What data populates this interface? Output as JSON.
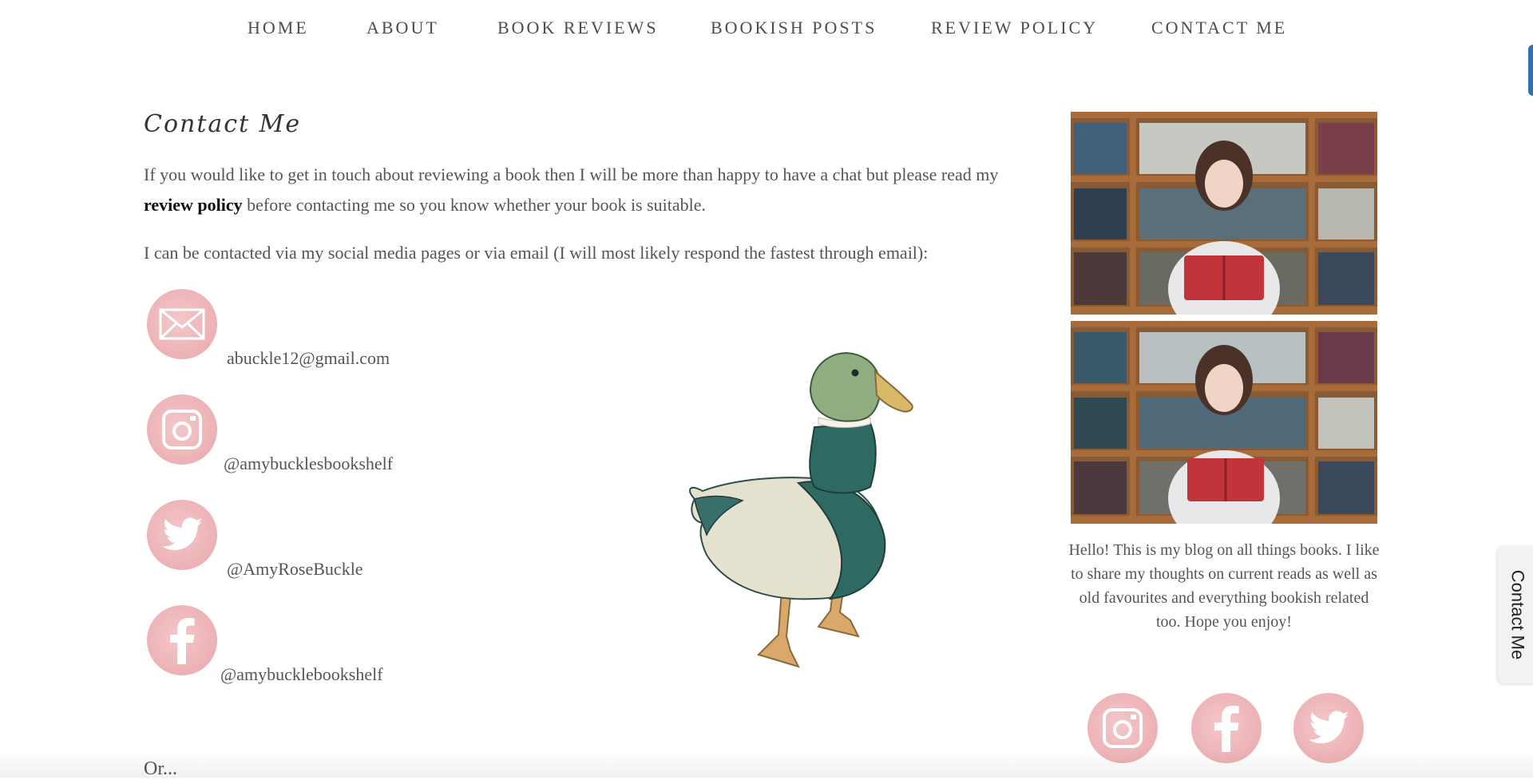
{
  "nav": {
    "items": [
      {
        "label": "HOME"
      },
      {
        "label": "ABOUT"
      },
      {
        "label": "BOOK REVIEWS"
      },
      {
        "label": "BOOKISH POSTS"
      },
      {
        "label": "REVIEW POLICY"
      },
      {
        "label": "CONTACT ME"
      }
    ]
  },
  "main": {
    "title": "Contact Me",
    "intro_before": "If you would like to get in touch about reviewing a book then I will be more than happy to have a chat but please read my ",
    "intro_link": "review policy",
    "intro_after": " before contacting me so you know whether your book is suitable.",
    "contact_line": "I can be contacted via my social media pages or via email (I will most likely respond the fastest through email):",
    "contacts": [
      {
        "icon": "envelope-icon",
        "text": "abuckle12@gmail.com"
      },
      {
        "icon": "instagram-icon",
        "text": "@amybucklesbookshelf"
      },
      {
        "icon": "twitter-icon",
        "text": "@AmyRoseBuckle"
      },
      {
        "icon": "facebook-icon",
        "text": "@amybucklebookshelf"
      }
    ],
    "or_text": "Or..."
  },
  "sidebar": {
    "bio": "Hello! This is my blog on all things books. I like to share my thoughts on current reads as well as old favourites and everything bookish related too. Hope you enjoy!",
    "social": [
      "instagram-icon",
      "facebook-icon",
      "twitter-icon"
    ]
  },
  "floating_tab": {
    "label": "Contact Me"
  },
  "colors": {
    "icon_pink": "#eeb6b9",
    "accent_blue": "#2d6fbd"
  }
}
